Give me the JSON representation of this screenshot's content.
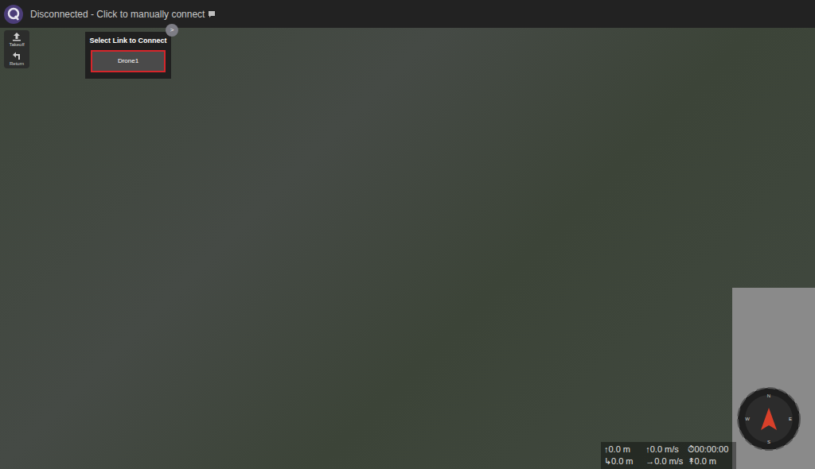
{
  "toolbar": {
    "status": "Disconnected - Click to manually connect"
  },
  "plan_tools": [
    {
      "label": "Takeoff"
    },
    {
      "label": "Return"
    }
  ],
  "connect_popup": {
    "title": "Select Link to Connect",
    "expand_button": ">",
    "links": [
      {
        "label": "Drone1",
        "selected": true
      }
    ]
  },
  "telemetry": [
    [
      {
        "icon": "↑",
        "value": "0.0 m"
      },
      {
        "icon": "↑",
        "value": "0.0 m/s"
      },
      {
        "icon": "⏱",
        "value": "00:00:00"
      }
    ],
    [
      {
        "icon": "↳",
        "value": "0.0 m"
      },
      {
        "icon": "→",
        "value": "0.0 m/s"
      },
      {
        "icon": "↟",
        "value": "0.0 m"
      }
    ]
  ],
  "compass": {
    "labels": [
      "N",
      "E",
      "S",
      "W"
    ]
  }
}
